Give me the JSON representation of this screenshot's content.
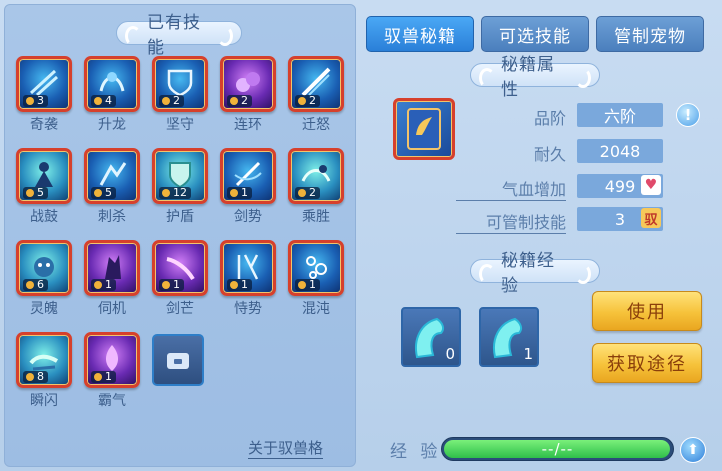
{
  "left": {
    "title": "已有技能",
    "skills": [
      {
        "name": "奇袭",
        "level": "3"
      },
      {
        "name": "升龙",
        "level": "4"
      },
      {
        "name": "坚守",
        "level": "2"
      },
      {
        "name": "连环",
        "level": "2"
      },
      {
        "name": "迁怒",
        "level": "2"
      },
      {
        "name": "战鼓",
        "level": "5"
      },
      {
        "name": "刺杀",
        "level": "5"
      },
      {
        "name": "护盾",
        "level": "12"
      },
      {
        "name": "剑势",
        "level": "1"
      },
      {
        "name": "乘胜",
        "level": "2"
      },
      {
        "name": "灵魄",
        "level": "6"
      },
      {
        "name": "伺机",
        "level": "1"
      },
      {
        "name": "剑芒",
        "level": "1"
      },
      {
        "name": "恃势",
        "level": "1"
      },
      {
        "name": "混沌",
        "level": "1"
      },
      {
        "name": "瞬闪",
        "level": "8"
      },
      {
        "name": "霸气",
        "level": "1"
      }
    ],
    "link": "关于驭兽格"
  },
  "tabs": [
    {
      "label": "驭兽秘籍",
      "active": true
    },
    {
      "label": "可选技能",
      "active": false
    },
    {
      "label": "管制宠物",
      "active": false
    }
  ],
  "props": {
    "title": "秘籍属性",
    "rank_label": "品阶",
    "rank_value": "六阶",
    "durability_label": "耐久",
    "durability_value": "2048",
    "hp_label": "气血增加",
    "hp_value": "499",
    "ctrl_label": "可管制技能",
    "ctrl_value": "3",
    "ctrl_badge": "驭",
    "info": "!",
    "heart": "♥"
  },
  "exp": {
    "title": "秘籍经验",
    "items": [
      {
        "count": "0"
      },
      {
        "count": "1"
      }
    ],
    "use_label": "使用",
    "obtain_label": "获取途径",
    "label": "经 验",
    "value": "--/--",
    "up": "⬆"
  },
  "colors": {
    "accent": "#2a7fd8",
    "gold": "#f6c23a",
    "border_red": "#d6402c"
  }
}
